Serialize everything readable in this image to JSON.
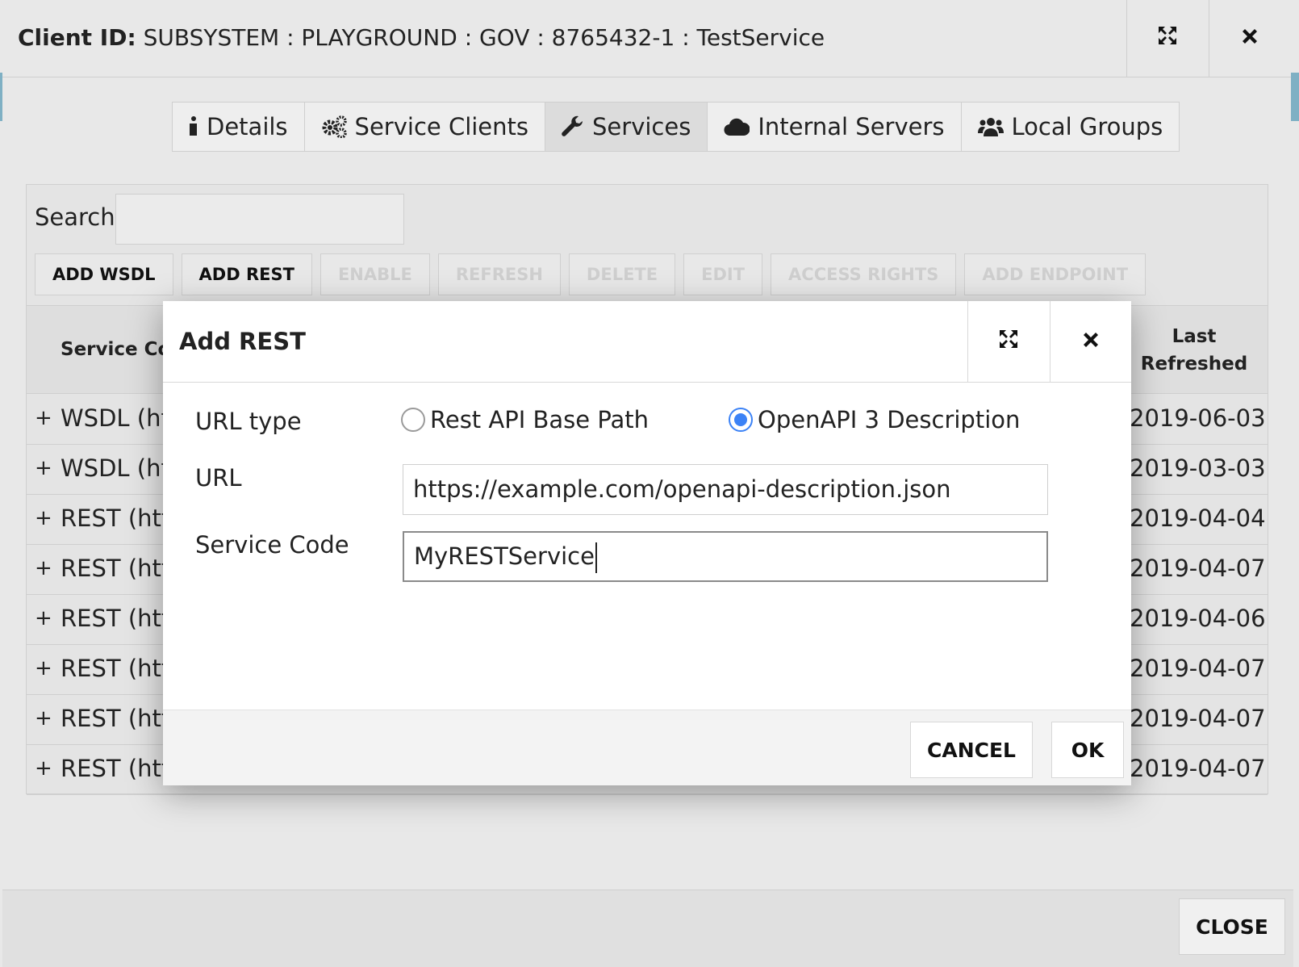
{
  "window": {
    "client_label": "Client ID:",
    "client_value": "SUBSYSTEM : PLAYGROUND : GOV : 8765432-1 : TestService"
  },
  "tabs": [
    {
      "label": "Details",
      "icon": "info-icon"
    },
    {
      "label": "Service Clients",
      "icon": "gears-icon"
    },
    {
      "label": "Services",
      "icon": "wrench-icon"
    },
    {
      "label": "Internal Servers",
      "icon": "cloud-icon"
    },
    {
      "label": "Local Groups",
      "icon": "users-icon"
    }
  ],
  "search": {
    "label": "Search",
    "value": ""
  },
  "toolbar": {
    "add_wsdl": "ADD WSDL",
    "add_rest": "ADD REST",
    "enable": "ENABLE",
    "refresh": "REFRESH",
    "delete": "DELETE",
    "edit": "EDIT",
    "access_rights": "ACCESS RIGHTS",
    "add_endpoint": "ADD ENDPOINT"
  },
  "table": {
    "col_service": "Service Coc",
    "col_last_line1": "Last",
    "col_last_line2": "Refreshed",
    "rows": [
      {
        "name": "WSDL (ht",
        "date": "2019-06-03"
      },
      {
        "name": "WSDL (ht",
        "date": "2019-03-03"
      },
      {
        "name": "REST (htt",
        "date": "2019-04-04"
      },
      {
        "name": "REST (htt",
        "date": "2019-04-07"
      },
      {
        "name": "REST (htt",
        "date": "2019-04-06"
      },
      {
        "name": "REST (htt",
        "date": "2019-04-07"
      },
      {
        "name": "REST (htt",
        "date": "2019-04-07"
      },
      {
        "name": "REST (htt",
        "date": "2019-04-07"
      }
    ]
  },
  "footer": {
    "close": "CLOSE"
  },
  "modal": {
    "title": "Add REST",
    "url_type_label": "URL type",
    "radio_rest": "Rest API Base Path",
    "radio_openapi": "OpenAPI 3 Description",
    "url_label": "URL",
    "url_value": "https://example.com/openapi-description.json",
    "service_code_label": "Service Code",
    "service_code_value": "MyRESTService",
    "cancel": "CANCEL",
    "ok": "OK"
  },
  "colors": {
    "accent": "#3b82f6"
  }
}
